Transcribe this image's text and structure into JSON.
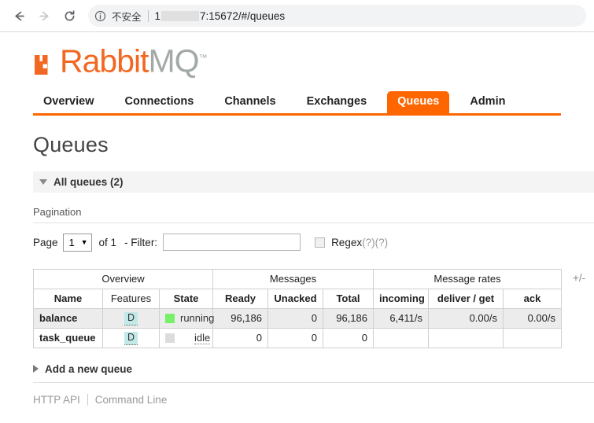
{
  "browser": {
    "back_icon": "back-arrow-icon",
    "forward_icon": "forward-arrow-icon",
    "reload_icon": "reload-icon",
    "info_icon": "info-circle-icon",
    "security_label": "不安全",
    "url_prefix": "1",
    "url_suffix": "7:15672/#/queues"
  },
  "logo": {
    "mark": "rabbitmq-logo-mark",
    "brand_primary": "Rabbit",
    "brand_secondary": "MQ",
    "trademark": "™",
    "color_orange": "#f26822",
    "color_gray": "#a3aaa6"
  },
  "nav": {
    "items": [
      {
        "label": "Overview",
        "active": false
      },
      {
        "label": "Connections",
        "active": false
      },
      {
        "label": "Channels",
        "active": false
      },
      {
        "label": "Exchanges",
        "active": false
      },
      {
        "label": "Queues",
        "active": true
      },
      {
        "label": "Admin",
        "active": false
      }
    ],
    "accent": "#ff6600"
  },
  "page": {
    "title": "Queues",
    "section_label": "All queues (2)",
    "pagination_label": "Pagination",
    "add_new_label": "Add a new queue"
  },
  "pagination": {
    "page_label": "Page",
    "page_value": "1",
    "of_label": "of 1",
    "filter_label": "- Filter:",
    "filter_value": "",
    "filter_placeholder": "",
    "regex_label": "Regex",
    "help_1": "(?)",
    "help_2": "(?)",
    "regex_checked": false
  },
  "table": {
    "groups": [
      {
        "label": "Overview",
        "span": 3
      },
      {
        "label": "Messages",
        "span": 3
      },
      {
        "label": "Message rates",
        "span": 3
      }
    ],
    "columns": [
      {
        "label": "Name",
        "bold": true
      },
      {
        "label": "Features",
        "bold": false
      },
      {
        "label": "State",
        "bold": true
      },
      {
        "label": "Ready",
        "bold": true
      },
      {
        "label": "Unacked",
        "bold": true
      },
      {
        "label": "Total",
        "bold": true
      },
      {
        "label": "incoming",
        "bold": true
      },
      {
        "label": "deliver / get",
        "bold": true
      },
      {
        "label": "ack",
        "bold": true
      }
    ],
    "toggle_columns_label": "+/-",
    "rows": [
      {
        "name": "balance",
        "features": "D",
        "state": "running",
        "state_kind": "running",
        "ready": "96,186",
        "unacked": "0",
        "total": "96,186",
        "incoming": "6,411/s",
        "deliver_get": "0.00/s",
        "ack": "0.00/s"
      },
      {
        "name": "task_queue",
        "features": "D",
        "state": "idle",
        "state_kind": "idle",
        "ready": "0",
        "unacked": "0",
        "total": "0",
        "incoming": "",
        "deliver_get": "",
        "ack": ""
      }
    ]
  },
  "footer": {
    "http_api": "HTTP API",
    "command_line": "Command Line"
  }
}
